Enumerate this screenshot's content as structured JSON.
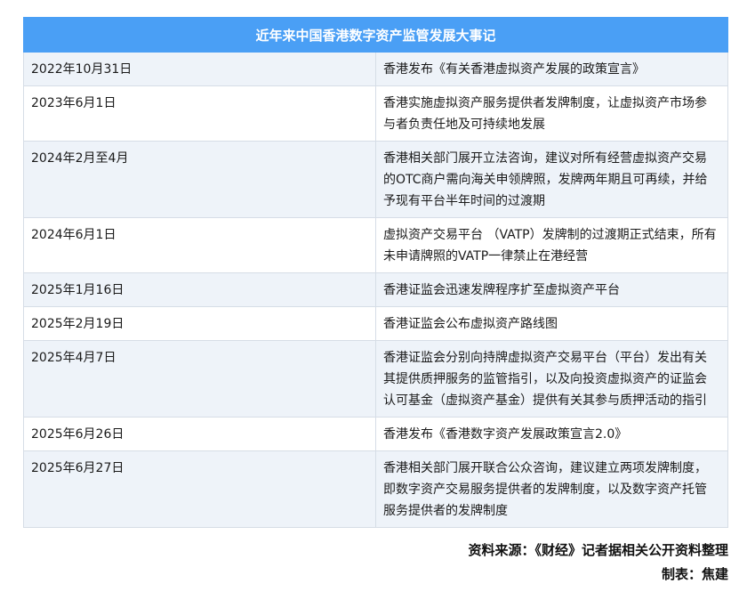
{
  "table": {
    "title": "近年来中国香港数字资产监管发展大事记",
    "rows": [
      {
        "date": "2022年10月31日",
        "event": "香港发布《有关香港虚拟资产发展的政策宣言》"
      },
      {
        "date": "2023年6月1日",
        "event": "香港实施虚拟资产服务提供者发牌制度，让虚拟资产市场参与者负责任地及可持续地发展"
      },
      {
        "date": "2024年2月至4月",
        "event": "香港相关部门展开立法咨询，建议对所有经营虚拟资产交易的OTC商户需向海关申领牌照，发牌两年期且可再续，并给予现有平台半年时间的过渡期"
      },
      {
        "date": "2024年6月1日",
        "event": "虚拟资产交易平台 （VATP）发牌制的过渡期正式结束，所有未申请牌照的VATP一律禁止在港经营"
      },
      {
        "date": "2025年1月16日",
        "event": "香港证监会迅速发牌程序扩至虚拟资产平台"
      },
      {
        "date": "2025年2月19日",
        "event": "香港证监会公布虚拟资产路线图"
      },
      {
        "date": "2025年4月7日",
        "event": "香港证监会分别向持牌虚拟资产交易平台（平台）发出有关其提供质押服务的监管指引，以及向投资虚拟资产的证监会认可基金（虚拟资产基金）提供有关其参与质押活动的指引"
      },
      {
        "date": "2025年6月26日",
        "event": "香港发布《香港数字资产发展政策宣言2.0》"
      },
      {
        "date": "2025年6月27日",
        "event": "香港相关部门展开联合公众咨询，建议建立两项发牌制度，即数字资产交易服务提供者的发牌制度，以及数字资产托管服务提供者的发牌制度"
      }
    ]
  },
  "footer": {
    "source": "资料来源：《财经》记者据相关公开资料整理",
    "maker": "制表：焦建"
  }
}
